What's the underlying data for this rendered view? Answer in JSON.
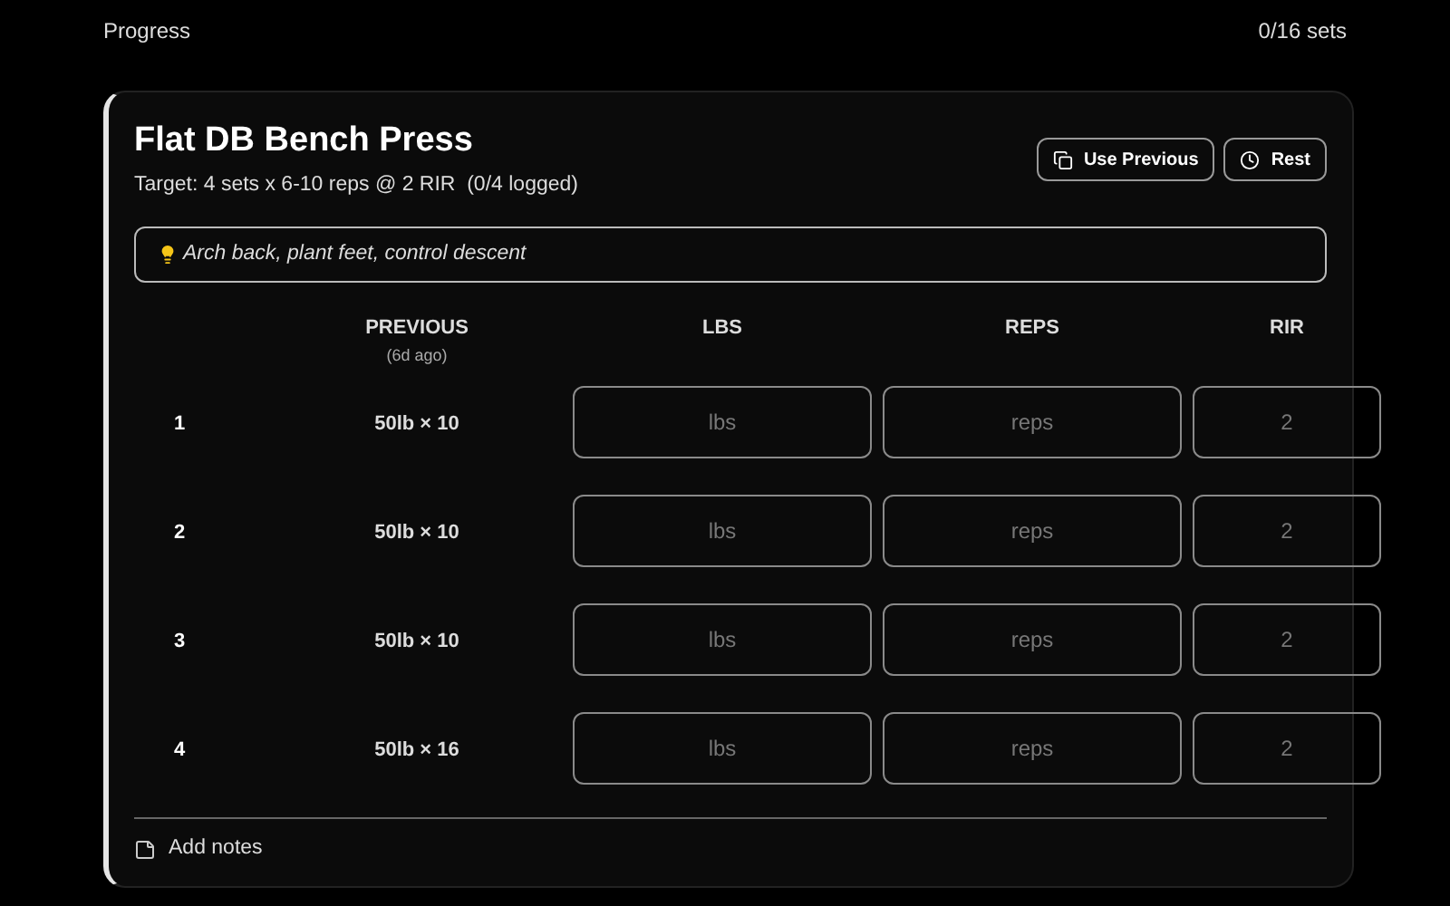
{
  "progress": {
    "label": "Progress",
    "count": "0/16 sets"
  },
  "exercise": {
    "title": "Flat DB Bench Press",
    "target": "Target: 4 sets x 6-10 reps @ 2 RIR",
    "logged": "(0/4 logged)",
    "buttons": [
      {
        "label": "Use Previous",
        "kind": "copy"
      },
      {
        "label": "Rest",
        "kind": "clock"
      }
    ],
    "tip": "Arch back, plant feet, control descent",
    "columns": {
      "previous": "PREVIOUS",
      "previous_sub": "(6d ago)",
      "lbs": "LBS",
      "reps": "REPS",
      "rir": "RIR"
    },
    "sets": [
      {
        "number": "1",
        "previous": "50lb × 10",
        "lbs_placeholder": "lbs",
        "reps_placeholder": "reps",
        "rir_placeholder": "2"
      },
      {
        "number": "2",
        "previous": "50lb × 10",
        "lbs_placeholder": "lbs",
        "reps_placeholder": "reps",
        "rir_placeholder": "2"
      },
      {
        "number": "3",
        "previous": "50lb × 10",
        "lbs_placeholder": "lbs",
        "reps_placeholder": "reps",
        "rir_placeholder": "2"
      },
      {
        "number": "4",
        "previous": "50lb × 16",
        "lbs_placeholder": "lbs",
        "reps_placeholder": "reps",
        "rir_placeholder": "2"
      }
    ],
    "notes_link": "Add notes"
  }
}
